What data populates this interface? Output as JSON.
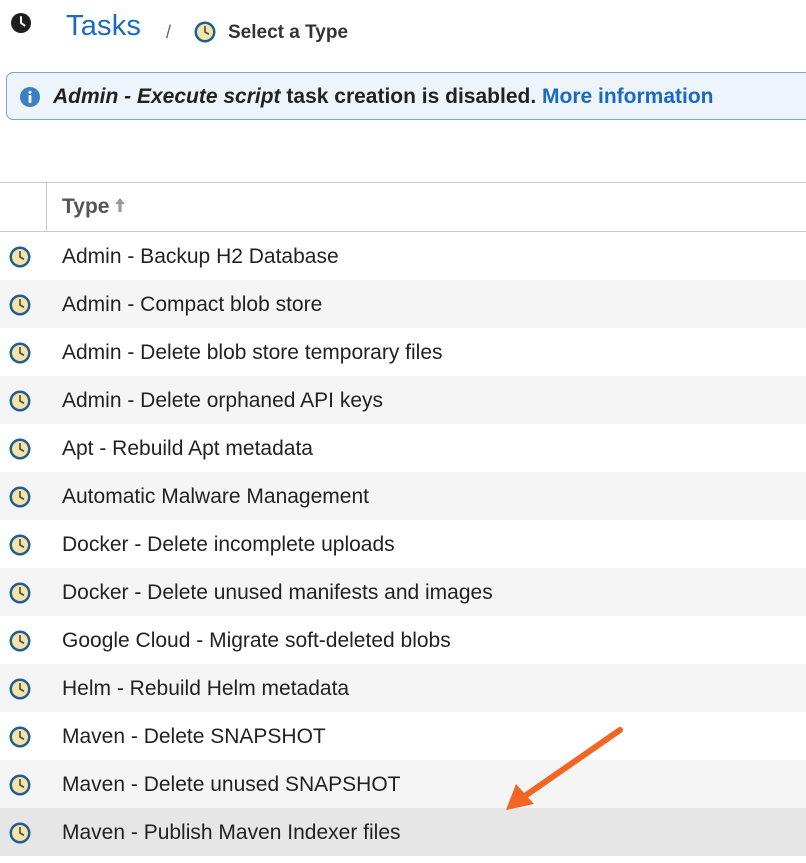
{
  "breadcrumb": {
    "root_label": "Tasks",
    "separator": "/",
    "current_label": "Select a Type"
  },
  "banner": {
    "task_name": "Admin - Execute script",
    "message": " task creation is disabled. ",
    "link_label": "More information"
  },
  "table": {
    "column_header": "Type",
    "sort": "ascending",
    "rows": [
      {
        "label": "Admin - Backup H2 Database"
      },
      {
        "label": "Admin - Compact blob store"
      },
      {
        "label": "Admin - Delete blob store temporary files"
      },
      {
        "label": "Admin - Delete orphaned API keys"
      },
      {
        "label": "Apt - Rebuild Apt metadata"
      },
      {
        "label": "Automatic Malware Management"
      },
      {
        "label": "Docker - Delete incomplete uploads"
      },
      {
        "label": "Docker - Delete unused manifests and images"
      },
      {
        "label": "Google Cloud - Migrate soft-deleted blobs"
      },
      {
        "label": "Helm - Rebuild Helm metadata"
      },
      {
        "label": "Maven - Delete SNAPSHOT"
      },
      {
        "label": "Maven - Delete unused SNAPSHOT"
      },
      {
        "label": "Maven - Publish Maven Indexer files"
      }
    ],
    "selected_row": 12
  },
  "colors": {
    "link": "#1a6ac4",
    "banner_border": "#7aa7d4",
    "banner_background": "#eef4fb",
    "arrow": "#f26522"
  },
  "icons": {
    "header": "clock-icon",
    "task_type": "task-clock-icon",
    "banner": "info-icon",
    "sort": "sort-up-arrow-icon"
  }
}
